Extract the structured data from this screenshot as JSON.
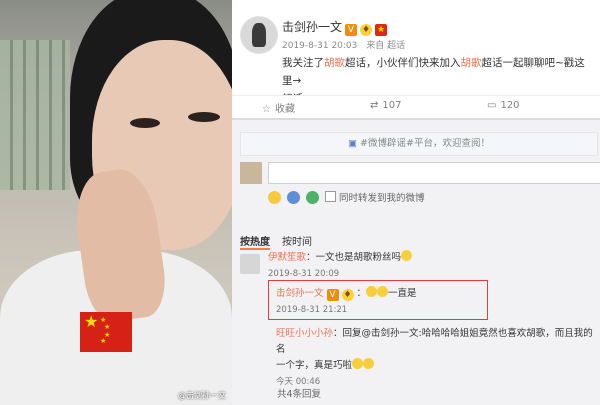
{
  "photo": {
    "watermark": "@击剑孙一文"
  },
  "post": {
    "username": "击剑孙一文",
    "time": "2019-8-31 20:03",
    "source": "来自",
    "source_name": "超话",
    "text_1": "我关注了",
    "topic_1": "胡歌",
    "text_2": "超话，小伙伴们快来加入",
    "topic_2": "胡歌",
    "text_3": "超话一起聊聊吧~戳这里→",
    "text_4": "超话"
  },
  "actions": {
    "favorite_label": "收藏",
    "repost_count": "107",
    "comment_count": "120"
  },
  "comments": {
    "notice": "#微博辟谣#平台，欢迎查阅！",
    "repost_label": "同时转发到我的微博",
    "sort_hot": "按热度",
    "sort_time": "按时间",
    "items": [
      {
        "user": "伊默笙歌",
        "text": "：一文也是胡歌粉丝吗",
        "time": "2019-8-31 20:09"
      },
      {
        "user": "击剑孙一文",
        "text": "一直是",
        "time": "2019-8-31 21:21"
      },
      {
        "user": "旺旺小小小孙",
        "text": "：回复@击剑孙一文:哈哈哈哈姐姐竟然也喜欢胡歌，而且我的名",
        "text_cont": "一个字，真是巧啦",
        "time": "今天 00:46"
      }
    ],
    "more": "共4条回复"
  },
  "colors": {
    "accent": "#eb7350",
    "highlight_box": "#e23b3b"
  }
}
